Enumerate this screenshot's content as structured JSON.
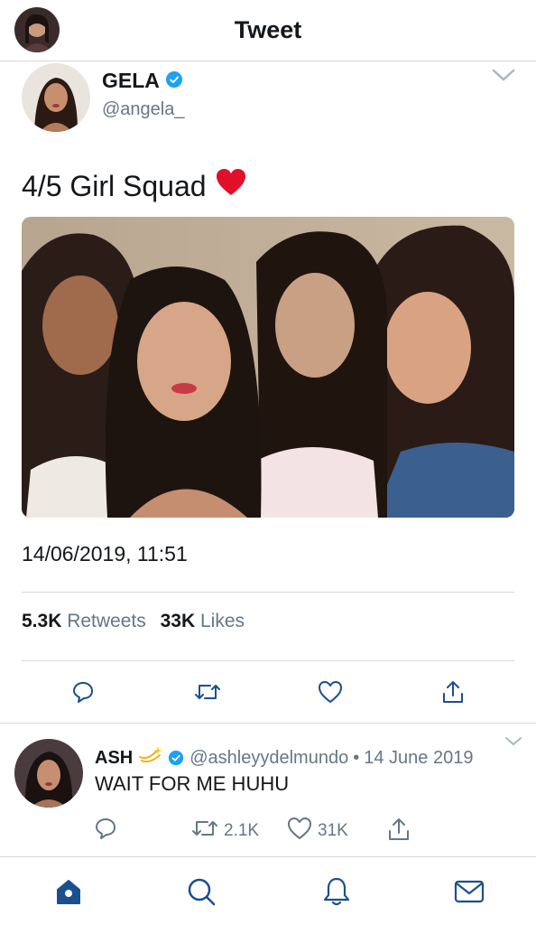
{
  "header": {
    "title": "Tweet"
  },
  "tweet": {
    "author_name": "GELA",
    "author_handle": "@angela_",
    "text": "4/5 Girl Squad",
    "timestamp": "14/06/2019, 11:51",
    "retweets_count": "5.3K",
    "retweets_label": "Retweets",
    "likes_count": "33K",
    "likes_label": "Likes"
  },
  "reply": {
    "name": "ASH",
    "handle": "@ashleyydelmundo",
    "separator": "•",
    "date": "14 June 2019",
    "text": "WAIT FOR ME HUHU",
    "retweets": "2.1K",
    "likes": "31K"
  },
  "colors": {
    "accent": "#1da1f2",
    "nav_active": "#1b4f8f",
    "muted": "#657786",
    "heart": "#e0102b"
  },
  "icons": {
    "verified": "verified-badge-icon",
    "reply": "reply-icon",
    "retweet": "retweet-icon",
    "like": "heart-icon",
    "share": "share-icon",
    "home": "home-icon",
    "search": "search-icon",
    "notifications": "bell-icon",
    "messages": "mail-icon"
  }
}
